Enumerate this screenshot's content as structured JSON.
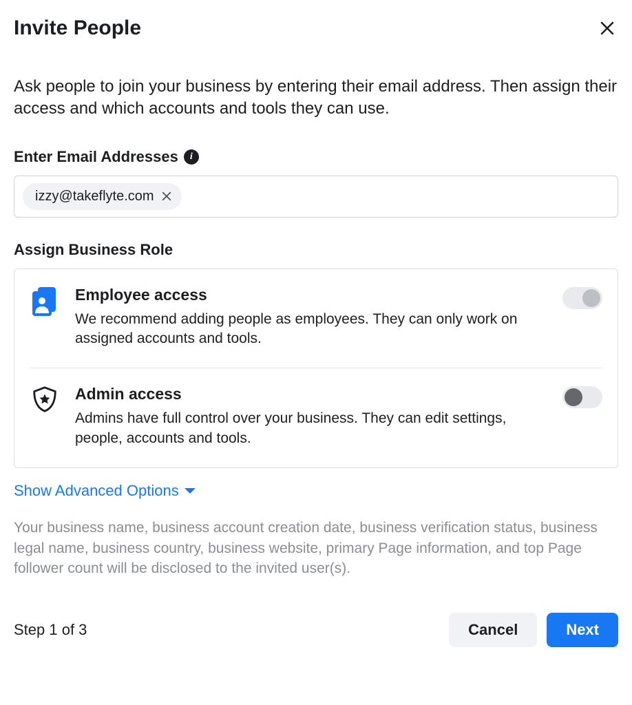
{
  "modal": {
    "title": "Invite People",
    "intro": "Ask people to join your business by entering their email address. Then assign their access and which accounts and tools they can use.",
    "email_section_label": "Enter Email Addresses",
    "email_chip": "izzy@takeflyte.com",
    "role_section_label": "Assign Business Role",
    "roles": {
      "employee": {
        "title": "Employee access",
        "desc": "We recommend adding people as employees. They can only work on assigned accounts and tools.",
        "toggle_on": false
      },
      "admin": {
        "title": "Admin access",
        "desc": "Admins have full control over your business. They can edit settings, people, accounts and tools.",
        "toggle_on": false
      }
    },
    "advanced_label": "Show Advanced Options",
    "disclosure": "Your business name, business account creation date, business verification status, business legal name, business country, business website, primary Page information, and top Page follower count will be disclosed to the invited user(s).",
    "step_text": "Step 1 of 3",
    "cancel_label": "Cancel",
    "next_label": "Next"
  }
}
